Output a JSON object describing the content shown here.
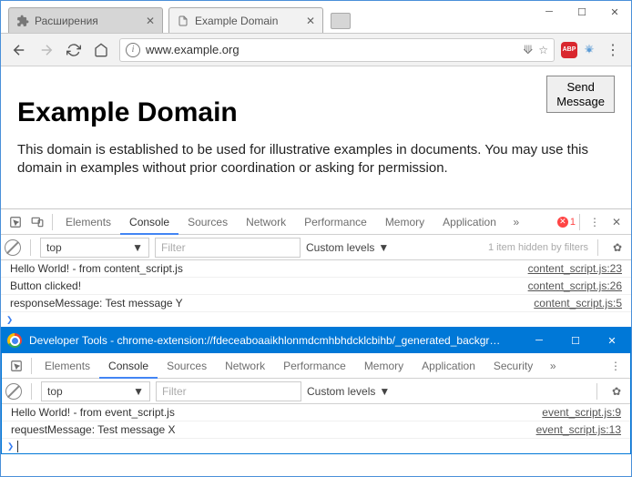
{
  "window": {
    "tabs": [
      {
        "title": "Расширения",
        "active": false,
        "favicon": "puzzle"
      },
      {
        "title": "Example Domain",
        "active": true,
        "favicon": "page"
      }
    ]
  },
  "address_bar": {
    "url": "www.example.org"
  },
  "page": {
    "button": "Send\nMessage",
    "heading": "Example Domain",
    "paragraph": "This domain is established to be used for illustrative examples in documents. You may use this domain in examples without prior coordination or asking for permission."
  },
  "devtools_docked": {
    "tabs": [
      "Elements",
      "Console",
      "Sources",
      "Network",
      "Performance",
      "Memory",
      "Application"
    ],
    "active_tab": "Console",
    "error_count": "1",
    "filter": {
      "context": "top",
      "placeholder": "Filter",
      "level": "Custom levels",
      "hidden": "1 item hidden by filters"
    },
    "console": [
      {
        "msg": "Hello World! - from content_script.js",
        "src": "content_script.js:23"
      },
      {
        "msg": "Button clicked!",
        "src": "content_script.js:26"
      },
      {
        "msg": "responseMessage: Test message Y",
        "src": "content_script.js:5"
      }
    ]
  },
  "devtools_window": {
    "title": "Developer Tools - chrome-extension://fdeceaboaaikhlonmdcmhbhdcklcbihb/_generated_backgr…",
    "tabs": [
      "Elements",
      "Console",
      "Sources",
      "Network",
      "Performance",
      "Memory",
      "Application",
      "Security"
    ],
    "active_tab": "Console",
    "filter": {
      "context": "top",
      "placeholder": "Filter",
      "level": "Custom levels"
    },
    "console": [
      {
        "msg": "Hello World! - from event_script.js",
        "src": "event_script.js:9"
      },
      {
        "msg": "requestMessage: Test message X",
        "src": "event_script.js:13"
      }
    ]
  }
}
